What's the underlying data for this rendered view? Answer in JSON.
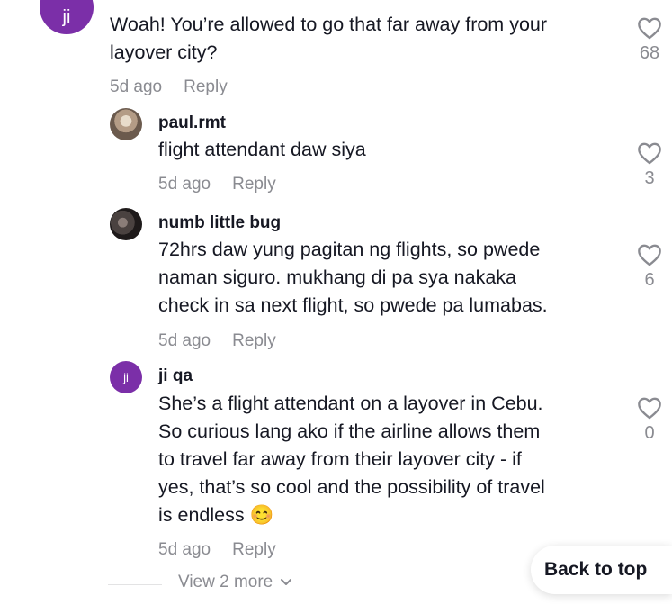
{
  "colors": {
    "accent_purple": "#7b2fa8",
    "meta_gray": "#8a8b91"
  },
  "comments": [
    {
      "avatar_text": "ji",
      "text_lines": [
        "Woah! You’re allowed to go that far away from your",
        "layover city?"
      ],
      "time": "5d ago",
      "reply_label": "Reply",
      "likes": "68",
      "like_icon": "heart-outline-icon"
    }
  ],
  "replies": [
    {
      "username": "paul.rmt",
      "text_lines": [
        "flight attendant daw siya"
      ],
      "time": "5d ago",
      "reply_label": "Reply",
      "likes": "3"
    },
    {
      "username": "numb little bug",
      "text_lines": [
        "72hrs daw yung pagitan ng flights, so pwede",
        "naman siguro. mukhang di pa sya nakaka",
        "check in sa next flight, so pwede pa lumabas."
      ],
      "time": "5d ago",
      "reply_label": "Reply",
      "likes": "6"
    },
    {
      "username": "ji qa",
      "avatar_text": "ji",
      "text_lines": [
        "She’s a flight attendant on a layover in Cebu.",
        "So curious lang ako if the airline allows them",
        "to travel far away from their layover city - if",
        "yes, that’s so cool and the possibility of travel",
        "is endless"
      ],
      "emoji": "😊",
      "time": "5d ago",
      "reply_label": "Reply",
      "likes": "0"
    }
  ],
  "view_more_label": "View 2 more",
  "back_to_top_label": "Back to top"
}
